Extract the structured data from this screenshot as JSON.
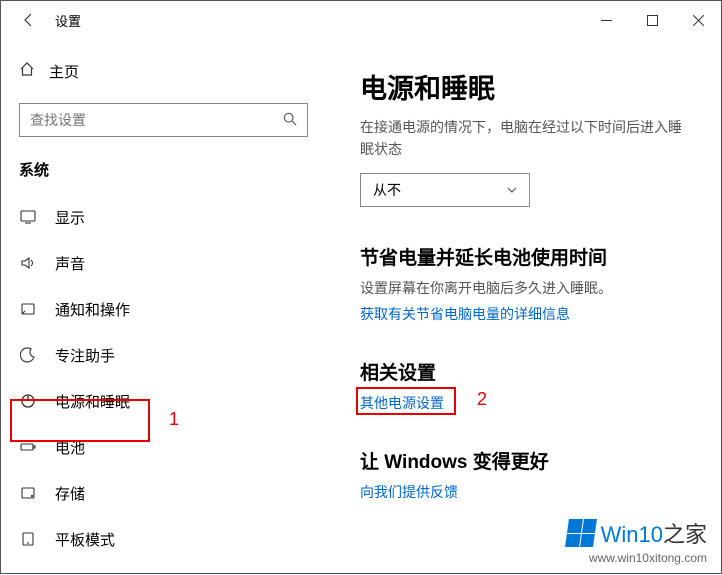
{
  "titlebar": {
    "title": "设置"
  },
  "sidebar": {
    "home": "主页",
    "search_placeholder": "查找设置",
    "section": "系统",
    "items": [
      {
        "label": "显示"
      },
      {
        "label": "声音"
      },
      {
        "label": "通知和操作"
      },
      {
        "label": "专注助手"
      },
      {
        "label": "电源和睡眠"
      },
      {
        "label": "电池"
      },
      {
        "label": "存储"
      },
      {
        "label": "平板模式"
      }
    ]
  },
  "main": {
    "heading": "电源和睡眠",
    "desc": "在接通电源的情况下，电脑在经过以下时间后进入睡眠状态",
    "dropdown_value": "从不",
    "save_heading": "节省电量并延长电池使用时间",
    "save_sub": "设置屏幕在你离开电脑后多久进入睡眠。",
    "save_link": "获取有关节省电脑电量的详细信息",
    "related_heading": "相关设置",
    "related_link": "其他电源设置",
    "better_heading": "让 Windows 变得更好",
    "feedback_link": "向我们提供反馈"
  },
  "annotations": {
    "n1": "1",
    "n2": "2"
  },
  "watermark": {
    "brand_a": "Win10",
    "brand_b": "之家",
    "url": "www.win10xitong.com"
  }
}
